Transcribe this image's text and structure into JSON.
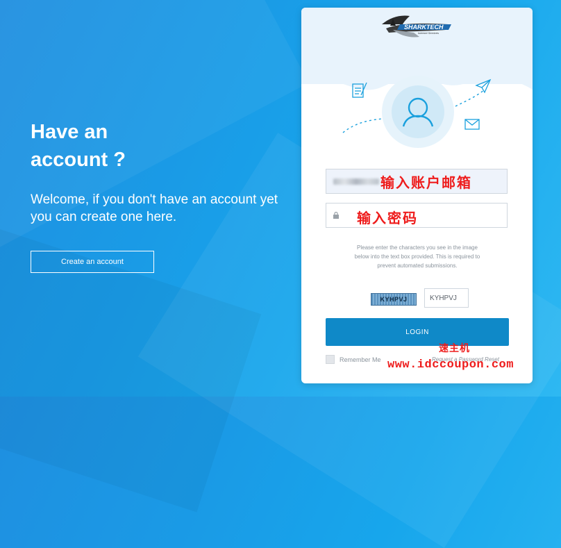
{
  "left": {
    "heading": "Have an account ?",
    "welcome": "Welcome, if you don't have an account yet you can create one here.",
    "create_button": "Create an account"
  },
  "logo": {
    "brand": "SHARKTECH",
    "tagline": "Internet Services"
  },
  "login": {
    "email_overlay": "输入账户邮箱",
    "password_overlay": "输入密码",
    "captcha_help": "Please enter the characters you see in the image below into the text box provided. This is required to prevent automated submissions.",
    "captcha_image_text": "KYHPVJ",
    "captcha_value": "KYHPVJ",
    "login_button": "LOGIN",
    "remember_label": "Remember Me",
    "reset_link": "Request a Password Reset"
  },
  "watermark": {
    "site_name": "速主机",
    "url": "www.idccoupon.com"
  },
  "colors": {
    "background": "#1a9be6",
    "accent_button": "#0f89c8",
    "illustration": "#1aa0dd",
    "overlay_red": "#ee1c1c"
  },
  "icons": [
    "user-avatar-icon",
    "notepad-icon",
    "paper-plane-icon",
    "envelope-icon",
    "lock-icon"
  ]
}
